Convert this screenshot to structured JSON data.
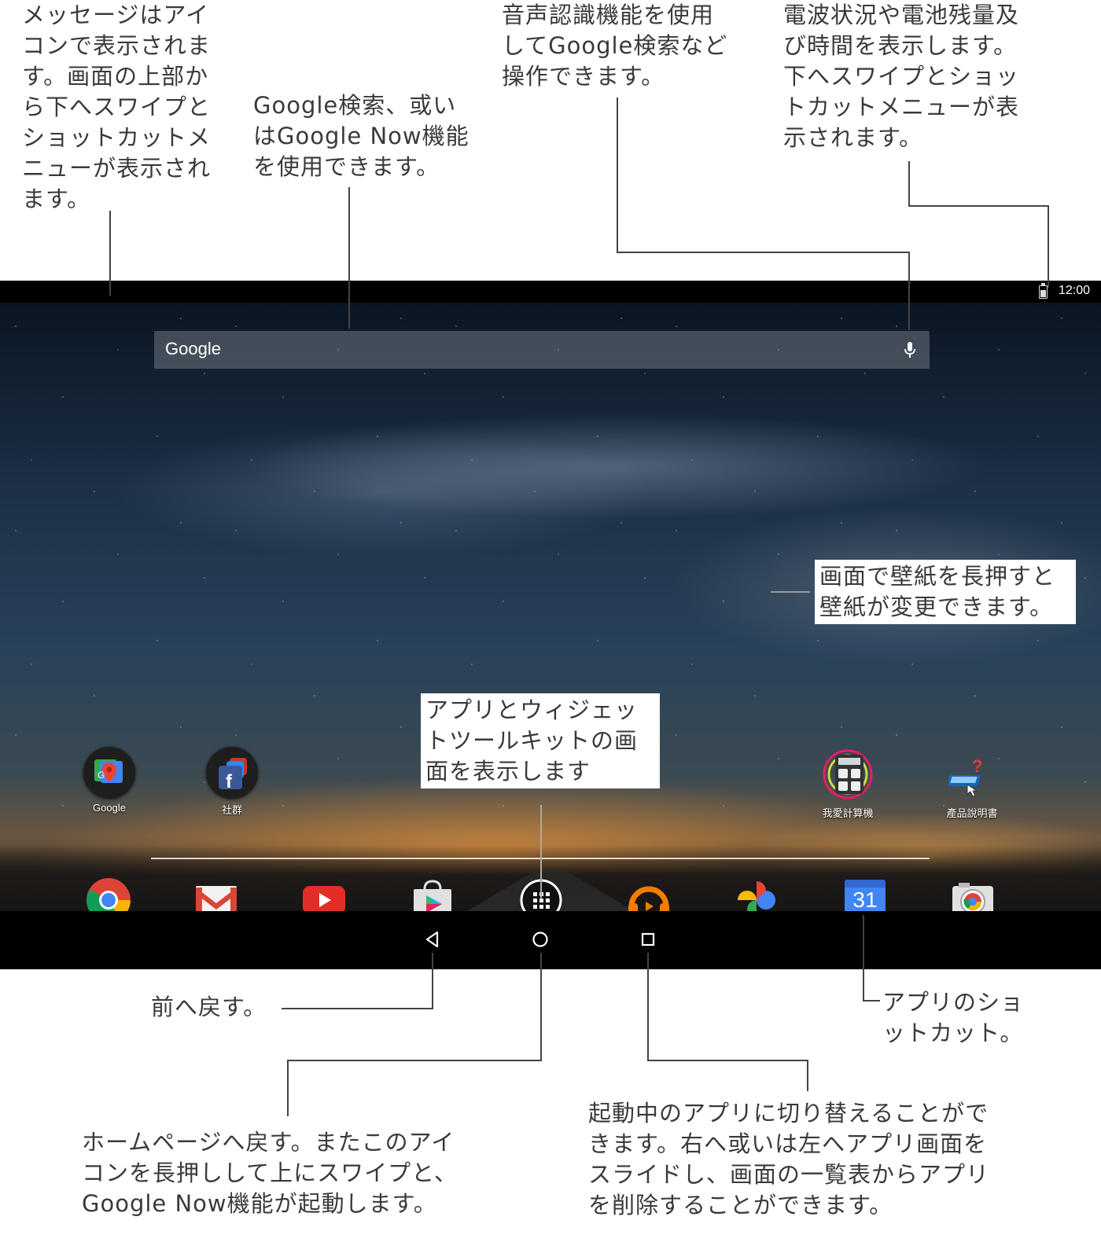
{
  "annotations": {
    "notifications": "メッセージはアイ\nコンで表示されま\nす。画面の上部か\nら下へスワイプと\nショットカットメ\nニューが表示され\nます。",
    "google_search": "Google検索、或い\nはGoogle Now機能\nを使用できます。",
    "voice": "音声認識機能を使用\nしてGoogle検索など\n操作できます。",
    "status": "電波状況や電池残量及\nび時間を表示します。\n下へスワイプとショッ\nトカットメニューが表\n示されます。",
    "wallpaper": "画面で壁紙を長押すと\n壁紙が変更できます。",
    "app_drawer": "アプリとウィジェッ\nトツールキットの画\n面を表示します",
    "back": "前へ戻す。",
    "home": "ホームページへ戻す。またこのアイ\nコンを長押しして上にスワイプと、\nGoogle Now機能が起動します。",
    "recents": "起動中のアプリに切り替えることがで\nきます。右へ或いは左へアプリ画面を\nスライドし、画面の一覧表からアプリ\nを削除することができます。",
    "shortcut": "アプリのショ\nットカット。"
  },
  "statusbar": {
    "time": "12:00",
    "battery_icon": "battery-icon"
  },
  "search": {
    "logo": "Google",
    "mic_icon": "mic-icon"
  },
  "home_apps": [
    {
      "label": "Google",
      "icon": "google-folder-icon"
    },
    {
      "label": "社群",
      "icon": "social-folder-icon"
    },
    {
      "label": "我愛計算機",
      "icon": "calculator-icon"
    },
    {
      "label": "產品說明書",
      "icon": "manual-icon"
    }
  ],
  "dock": [
    "chrome-icon",
    "gmail-icon",
    "youtube-icon",
    "play-store-icon",
    "app-drawer-icon",
    "play-music-icon",
    "photos-icon",
    "calendar-icon",
    "camera-icon"
  ],
  "calendar_day": "31",
  "navbar": [
    "back-icon",
    "home-icon",
    "recents-icon"
  ],
  "colors": {
    "screen_bg": "#000000",
    "accent_orange": "#f57c00",
    "calendar_blue": "#4285f4"
  }
}
